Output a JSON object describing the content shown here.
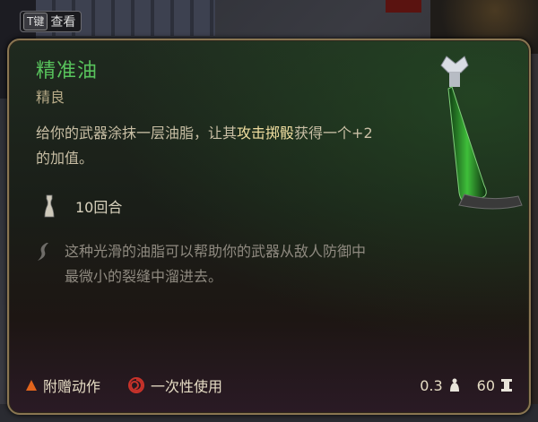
{
  "hotkey": {
    "key": "T键",
    "label": "查看"
  },
  "item": {
    "name": "精准油",
    "rarity": "精良",
    "description": {
      "part1": "给你的武器涂抹一层油脂，让其",
      "highlight": "攻击掷骰",
      "part2": "获得一个+2的加值。"
    },
    "duration": "10回合",
    "flavor": "这种光滑的油脂可以帮助你的武器从敌人防御中最微小的裂缝中溜进去。"
  },
  "footer": {
    "action_type": "附赠动作",
    "usage": "一次性使用",
    "weight": "0.3",
    "value": "60"
  },
  "colors": {
    "title_green": "#58c35c",
    "border_gold": "#8a7652",
    "highlight": "#f0dea0",
    "bonus_action_orange": "#e2641c",
    "single_use_red": "#c8322a"
  },
  "icons": [
    "hourglass-icon",
    "flavor-quill-icon",
    "bonus-action-triangle-icon",
    "single-use-spiral-icon",
    "weight-icon",
    "gold-coin-icon",
    "oil-bottle-icon"
  ]
}
